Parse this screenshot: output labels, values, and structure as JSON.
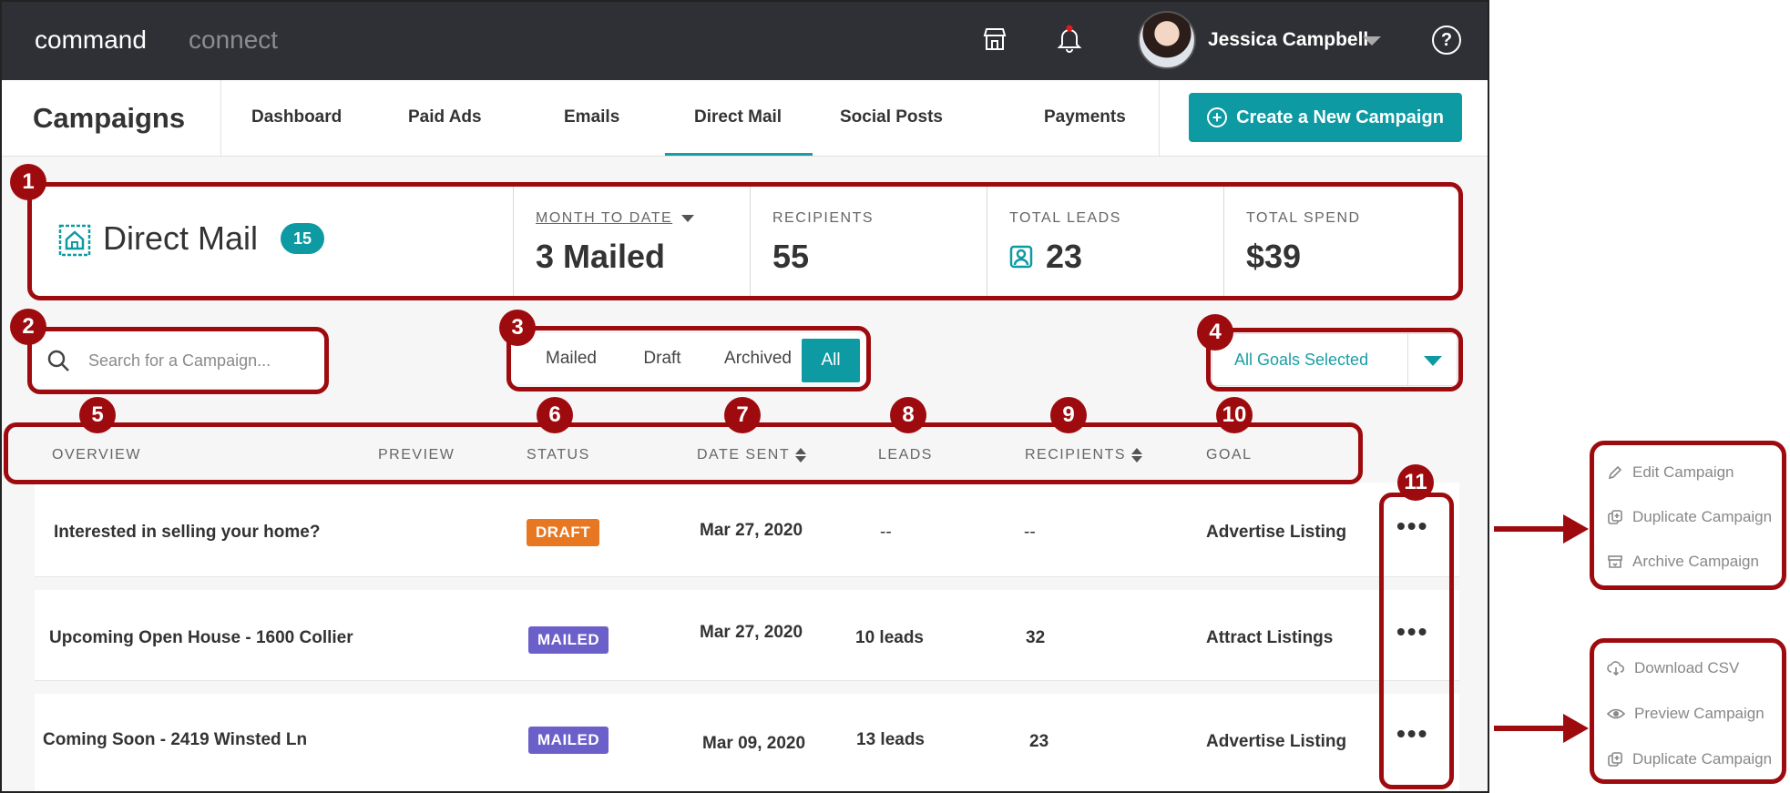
{
  "brand": {
    "primary": "command",
    "secondary": "connect"
  },
  "user": {
    "name": "Jessica Campbell"
  },
  "topbar_icons": [
    "store-icon",
    "bell-icon",
    "help-icon"
  ],
  "help_glyph": "?",
  "nav": {
    "title": "Campaigns",
    "tabs": [
      {
        "label": "Dashboard"
      },
      {
        "label": "Paid Ads"
      },
      {
        "label": "Emails"
      },
      {
        "label": "Direct Mail"
      },
      {
        "label": "Social Posts"
      },
      {
        "label": "Payments"
      }
    ],
    "active_tab": "Direct Mail",
    "create_button": "Create a New Campaign"
  },
  "summary": {
    "title": "Direct Mail",
    "count": "15",
    "stats": [
      {
        "label": "MONTH TO DATE",
        "value": "3 Mailed"
      },
      {
        "label": "RECIPIENTS",
        "value": "55"
      },
      {
        "label": "TOTAL LEADS",
        "value": "23"
      },
      {
        "label": "TOTAL SPEND",
        "value": "$39"
      }
    ]
  },
  "filters": {
    "search_placeholder": "Search for a Campaign...",
    "segments": [
      "Mailed",
      "Draft",
      "Archived",
      "All"
    ],
    "active_segment": "All",
    "goals_label": "All Goals Selected"
  },
  "table": {
    "headers": [
      "OVERVIEW",
      "PREVIEW",
      "STATUS",
      "DATE SENT",
      "LEADS",
      "RECIPIENTS",
      "GOAL"
    ],
    "rows": [
      {
        "overview": "Interested in selling your home?",
        "status": "DRAFT",
        "date": "Mar 27, 2020",
        "leads": "--",
        "recipients": "--",
        "goal": "Advertise Listing"
      },
      {
        "overview": "Upcoming Open House - 1600 Collier",
        "status": "MAILED",
        "date": "Mar 27, 2020",
        "leads": "10 leads",
        "recipients": "32",
        "goal": "Attract Listings"
      },
      {
        "overview": "Coming Soon - 2419 Winsted Ln",
        "status": "MAILED",
        "date": "Mar 09, 2020",
        "leads": "13 leads",
        "recipients": "23",
        "goal": "Advertise Listing"
      }
    ],
    "more_glyph": "•••"
  },
  "colors": {
    "accent": "#0d9aa3",
    "draft": "#e87722",
    "mailed": "#6b5fc9",
    "annotation": "#9e0b0f",
    "topbar": "#2f3035"
  },
  "annotations": [
    "1",
    "2",
    "3",
    "4",
    "5",
    "6",
    "7",
    "8",
    "9",
    "10",
    "11"
  ],
  "menus": {
    "draft_menu": [
      {
        "label": "Edit Campaign",
        "icon": "pencil-icon"
      },
      {
        "label": "Duplicate Campaign",
        "icon": "duplicate-icon"
      },
      {
        "label": "Archive Campaign",
        "icon": "archive-icon"
      }
    ],
    "mailed_menu": [
      {
        "label": "Download CSV",
        "icon": "cloud-download-icon"
      },
      {
        "label": "Preview Campaign",
        "icon": "eye-icon"
      },
      {
        "label": "Duplicate Campaign",
        "icon": "duplicate-icon"
      }
    ]
  }
}
